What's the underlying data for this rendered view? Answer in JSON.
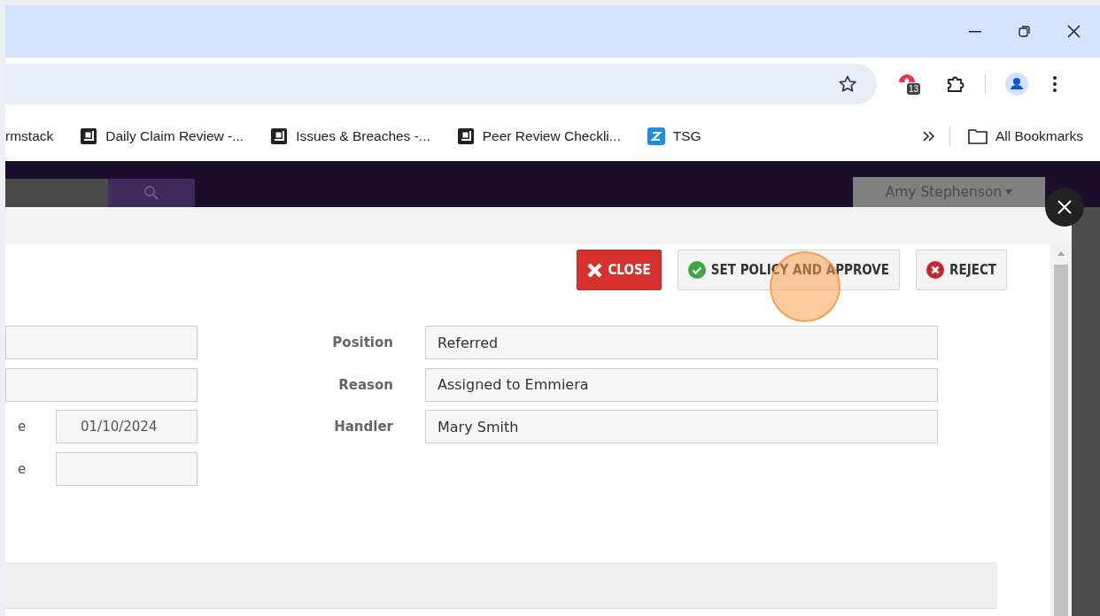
{
  "browser": {
    "extension_badge": "13",
    "bookmarks": [
      {
        "kind": "plain",
        "label": "rmstack"
      },
      {
        "kind": "page",
        "label": "Daily Claim Review -..."
      },
      {
        "kind": "page",
        "label": "Issues & Breaches -..."
      },
      {
        "kind": "page",
        "label": "Peer Review Checkli..."
      },
      {
        "kind": "app",
        "label": "TSG"
      }
    ],
    "all_bookmarks": "All Bookmarks"
  },
  "app_header": {
    "user": "Amy Stephenson"
  },
  "modal": {
    "buttons": [
      {
        "kind": "close",
        "label": "CLOSE"
      },
      {
        "kind": "approve",
        "label": "SET POLICY AND APPROVE"
      },
      {
        "kind": "reject",
        "label": "REJECT"
      }
    ],
    "left_fields": [
      {
        "kind": "text"
      },
      {
        "kind": "text"
      },
      {
        "kind": "date",
        "label": "e",
        "value": "01/10/2024"
      },
      {
        "kind": "date",
        "label": "e"
      }
    ],
    "right_fields": [
      {
        "label": "Position",
        "value": "Referred"
      },
      {
        "label": "Reason",
        "value": "Assigned to Emmiera"
      },
      {
        "label": "Handler",
        "value": "Mary Smith"
      }
    ]
  }
}
